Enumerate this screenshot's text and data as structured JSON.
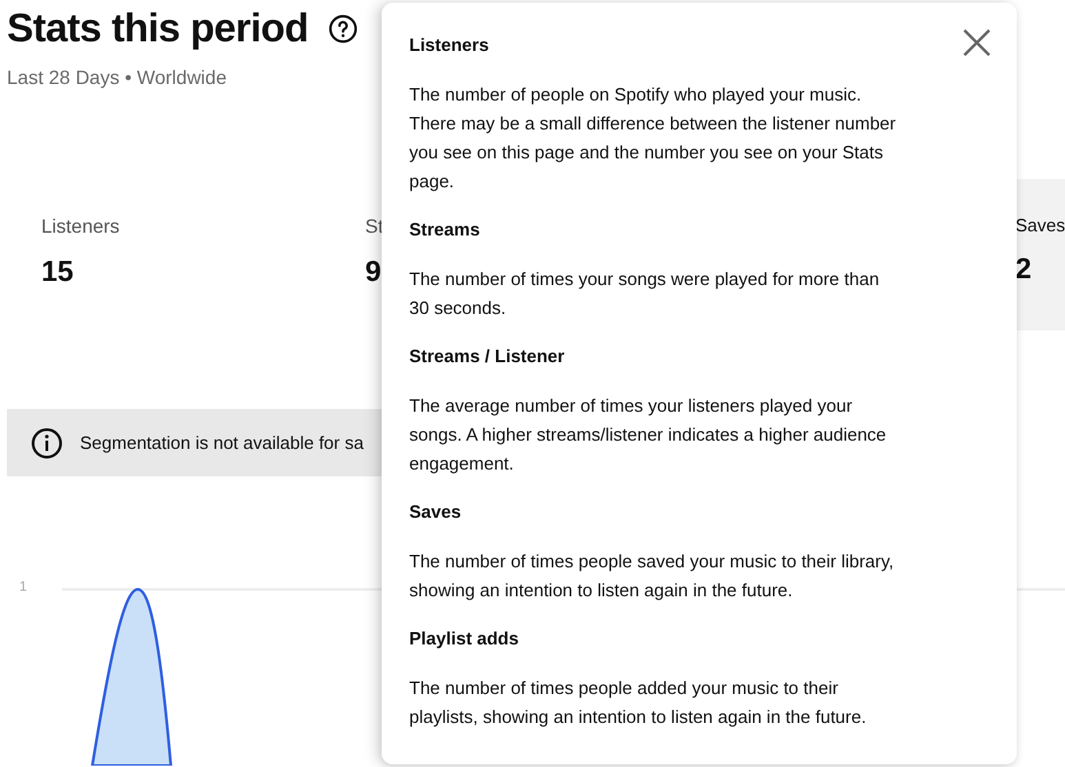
{
  "header": {
    "title": "Stats this period",
    "subtitle": "Last 28 Days • Worldwide"
  },
  "stats": [
    {
      "label": "Listeners",
      "value": "15",
      "kind": "plain"
    },
    {
      "label": "St",
      "value": "9",
      "kind": "plain"
    },
    {
      "label": "Saves",
      "value": "2",
      "kind": "shaded"
    }
  ],
  "notice": {
    "text": "Segmentation is not available for sa"
  },
  "chart": {
    "y_tick": "1"
  },
  "popup": {
    "sections": [
      {
        "title": "Listeners",
        "body": "The number of people on Spotify who played your music. There may be a small difference between the listener number you see on this page and the number you see on your Stats page."
      },
      {
        "title": "Streams",
        "body": "The number of times your songs were played for more than 30 seconds."
      },
      {
        "title": "Streams / Listener",
        "body": "The average number of times your listeners played your songs. A higher streams/listener indicates a higher audience engagement."
      },
      {
        "title": "Saves",
        "body": "The number of times people saved your music to their library, showing an intention to listen again in the future."
      },
      {
        "title": "Playlist adds",
        "body": "The number of times people added your music to their playlists, showing an intention to listen again in the future."
      }
    ]
  }
}
